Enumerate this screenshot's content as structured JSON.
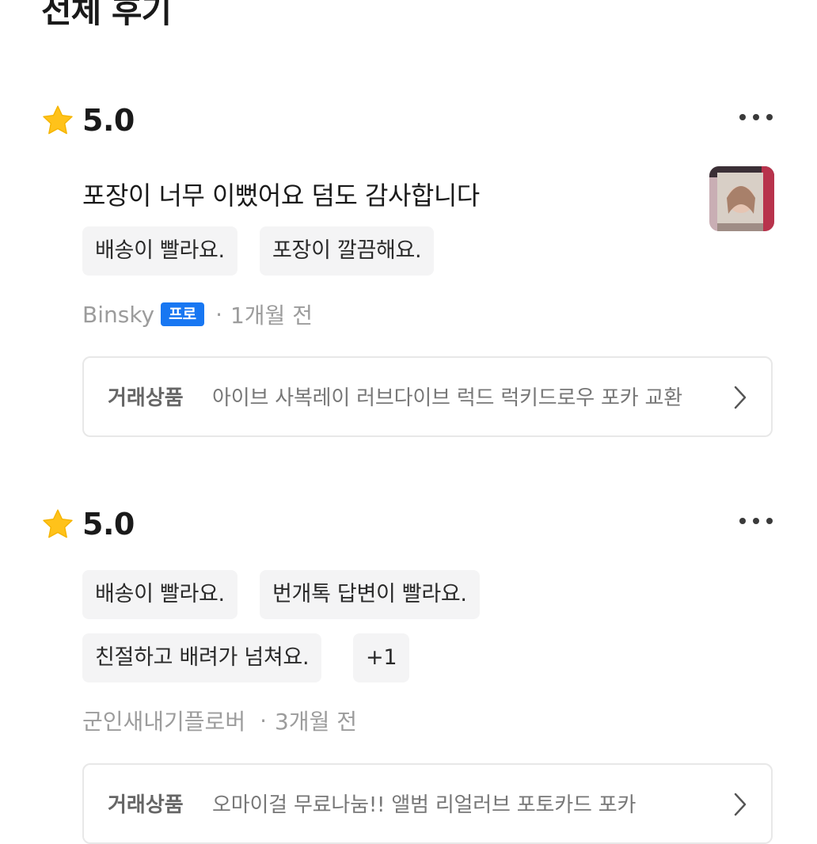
{
  "header": {
    "title": "전체 후기"
  },
  "reviews": [
    {
      "rating": "5.0",
      "text": "포장이 너무 이뻤어요 덤도 감사합니다",
      "tags": [
        "배송이 빨라요.",
        "포장이 깔끔해요."
      ],
      "author": "Binsky",
      "badge": "프로",
      "separator": "·",
      "time": "1개월 전",
      "item_label": "거래상품",
      "item_name": "아이브 사복레이 러브다이브 럭드 럭키드로우 포카 교환"
    },
    {
      "rating": "5.0",
      "tags": [
        "배송이 빨라요.",
        "번개톡 답변이 빨라요.",
        "친절하고 배려가 넘쳐요.",
        "+1"
      ],
      "author": "군인새내기플로버",
      "separator": "·",
      "time": "3개월 전",
      "item_label": "거래상품",
      "item_name": "오마이걸 무료나눔!! 앨범 리얼러브 포토카드 포카"
    }
  ],
  "colors": {
    "star": "#FFC21A",
    "badge": "#1877F2",
    "tag_bg": "#F4F4F5",
    "meta_text": "#9C9C9C"
  },
  "icons": {
    "rating": "star-icon",
    "menu": "more-icon",
    "link": "chevron-right-icon"
  }
}
